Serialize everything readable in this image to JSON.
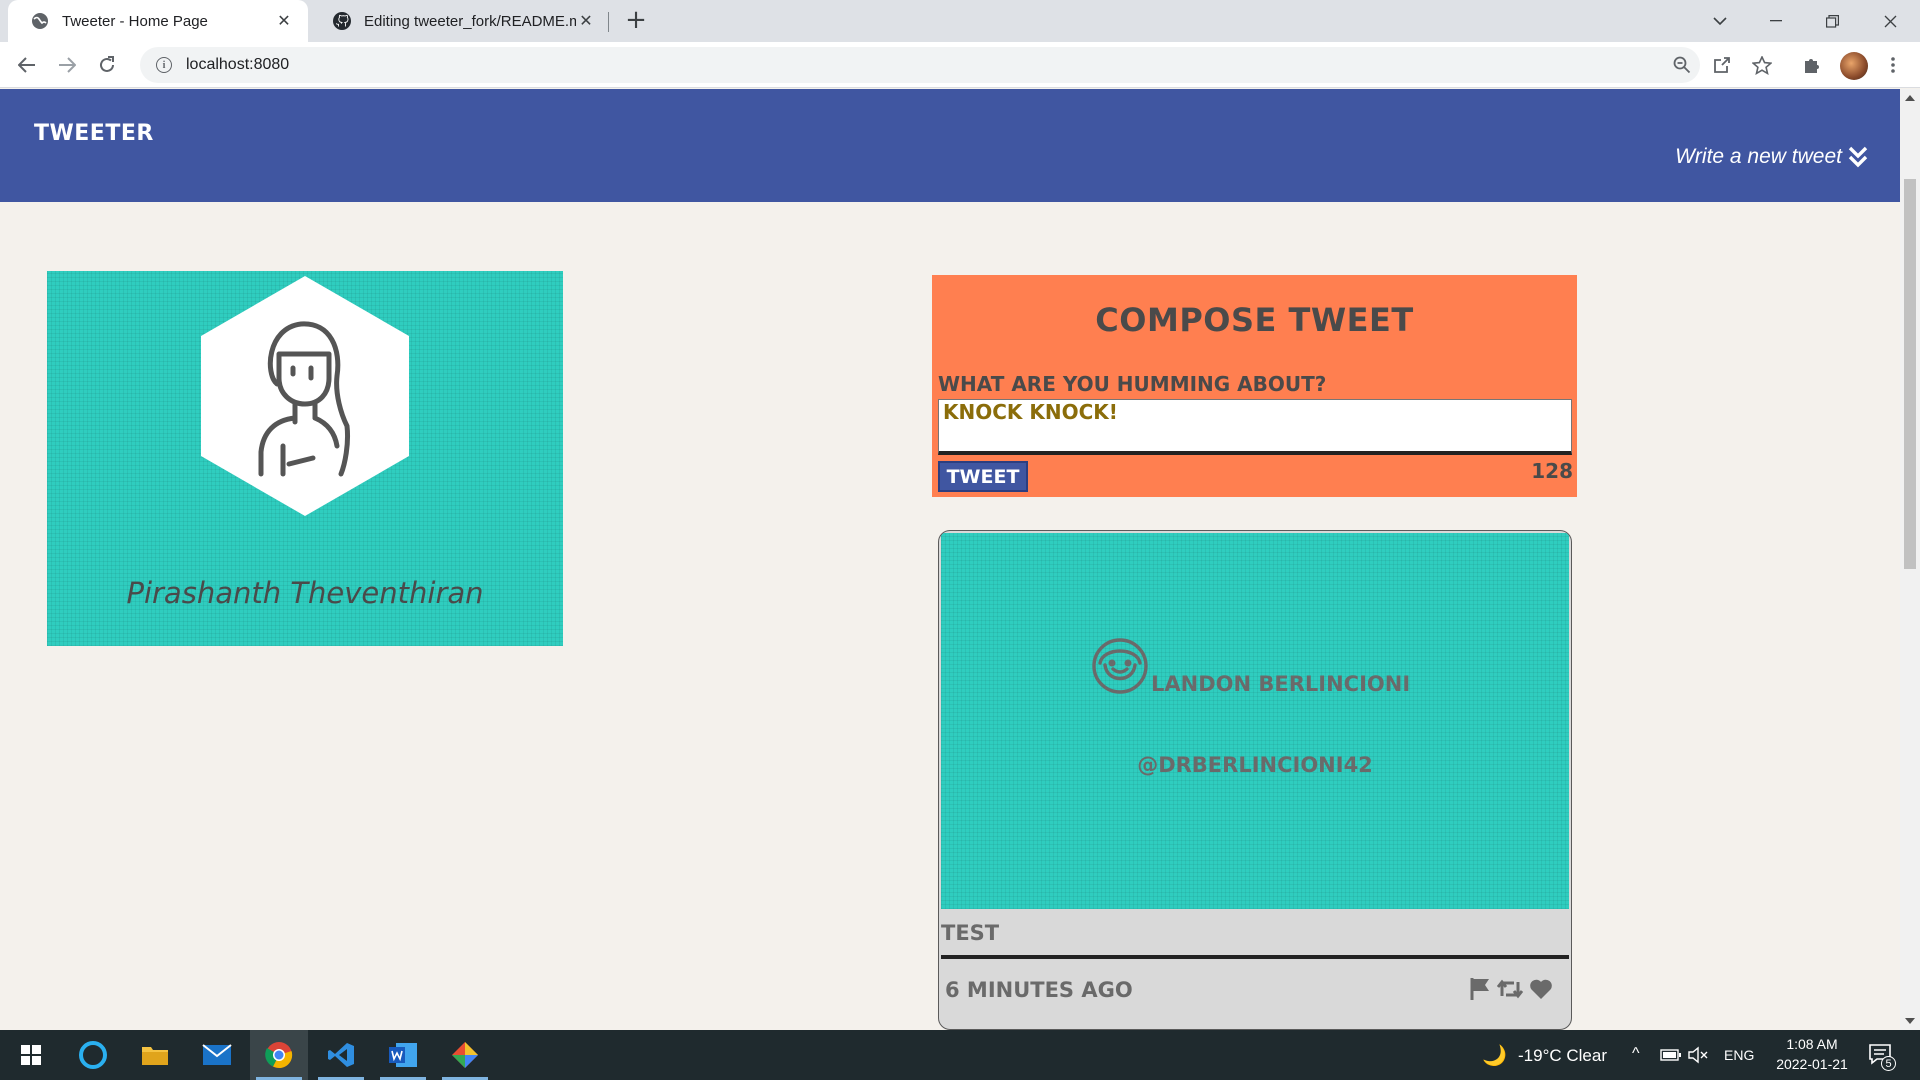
{
  "browser": {
    "tabs": [
      {
        "title": "Tweeter - Home Page",
        "icon": "globe-icon",
        "active": true
      },
      {
        "title": "Editing tweeter_fork/README.md",
        "icon": "github-icon",
        "active": false
      }
    ],
    "url": "localhost:8080"
  },
  "nav": {
    "brand": "TWEETER",
    "write_new": "Write a new tweet"
  },
  "profile": {
    "name": "Pirashanth Theventhiran"
  },
  "compose": {
    "title": "COMPOSE TWEET",
    "label": "WHAT ARE YOU HUMMING ABOUT?",
    "text": "KNOCK KNOCK!",
    "button": "TWEET",
    "counter": "128"
  },
  "tweet": {
    "user": "LANDON BERLINCIONI",
    "handle": "@DRBERLINCIONI42",
    "content": "TEST",
    "time": "6 MINUTES AGO"
  },
  "taskbar": {
    "weather": "-19°C  Clear",
    "language": "ENG",
    "time": "1:08 AM",
    "date": "2022-01-21",
    "notifications": "5"
  },
  "colors": {
    "nav": "#4056a1",
    "compose": "#ff7f50",
    "teal": "#2fcdbf",
    "page": "#f4f1ec"
  }
}
